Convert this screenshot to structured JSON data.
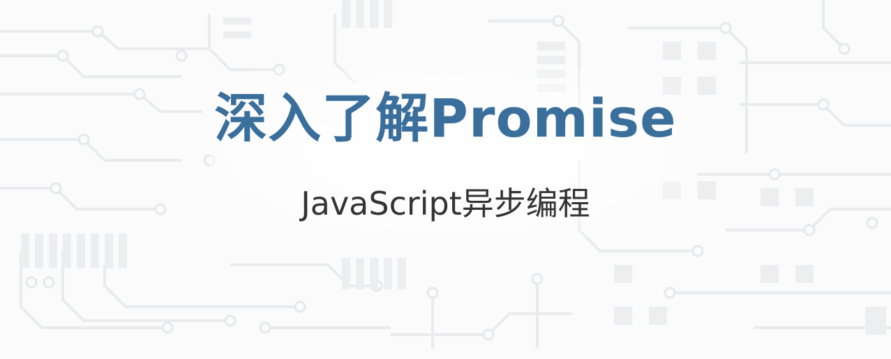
{
  "banner": {
    "title": "深入了解Promise",
    "subtitle": "JavaScript异步编程"
  },
  "colors": {
    "title": "#3a6f9c",
    "subtitle": "#333333",
    "background": "#fbfbfb",
    "circuit_pattern": "#e9ebec"
  }
}
